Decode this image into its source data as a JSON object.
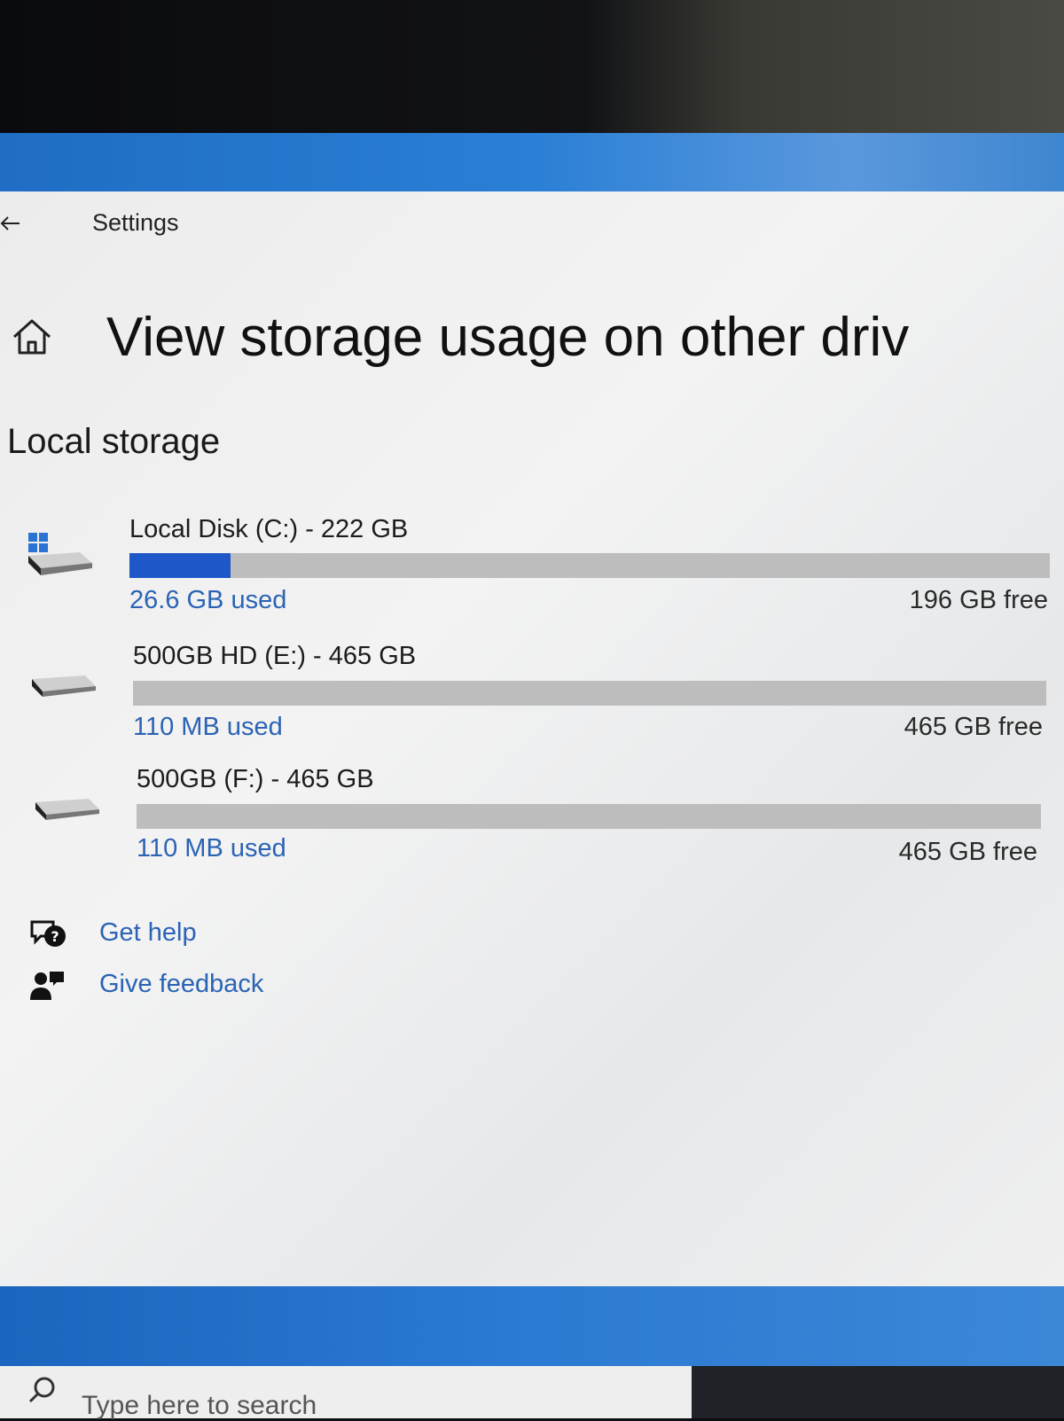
{
  "window": {
    "app_title": "Settings",
    "page_title": "View storage usage on other driv"
  },
  "local_storage": {
    "heading": "Local storage",
    "drives": [
      {
        "name": "Local Disk (C:) - 222 GB",
        "used": "26.6 GB used",
        "free": "196 GB free",
        "used_fraction": 0.11,
        "icon": "windows-drive-icon"
      },
      {
        "name": "500GB HD (E:) - 465 GB",
        "used": "110 MB used",
        "free": "465 GB free",
        "used_fraction": 0.0,
        "icon": "hard-drive-icon"
      },
      {
        "name": "500GB (F:) - 465 GB",
        "used": "110 MB used",
        "free": "465 GB free",
        "used_fraction": 0.0,
        "icon": "hard-drive-icon"
      }
    ]
  },
  "links": {
    "get_help": "Get help",
    "give_feedback": "Give feedback"
  },
  "taskbar": {
    "search_placeholder": "Type here to search"
  },
  "colors": {
    "accent": "#1e57c8",
    "link": "#2b63b5",
    "bar_track": "#bdbdbd"
  }
}
